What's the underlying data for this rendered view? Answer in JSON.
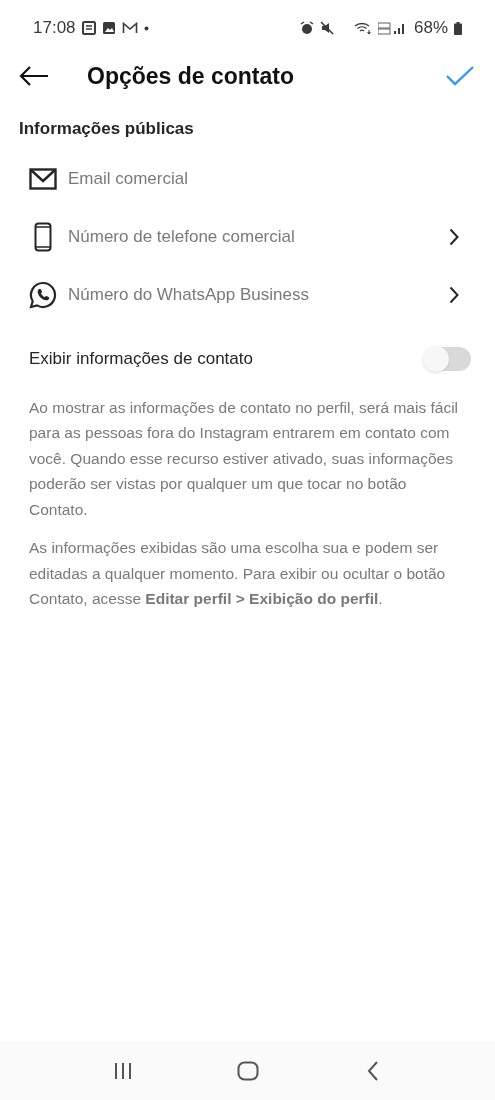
{
  "status_bar": {
    "time": "17:08",
    "battery": "68%"
  },
  "header": {
    "title": "Opções de contato"
  },
  "section_title": "Informações públicas",
  "items": [
    {
      "kind": "email",
      "label": "Email comercial",
      "chevron": false
    },
    {
      "kind": "phone",
      "label": "Número de telefone comercial",
      "chevron": true
    },
    {
      "kind": "whatsapp",
      "label": "Número do WhatsApp Business",
      "chevron": true
    }
  ],
  "display_toggle": {
    "label": "Exibir informações de contato",
    "on": false
  },
  "paragraphs": [
    "Ao mostrar as informações de contato no perfil, será mais fácil para as pessoas fora do Instagram entrarem em contato com você. Quando esse recurso estiver ativado, suas informações poderão ser vistas por qualquer um que tocar no botão Contato.",
    "As informações exibidas são uma escolha sua e podem ser editadas a qualquer momento. Para exibir ou ocultar o botão Contato, acesse **Editar perfil > Exibição do perfil**."
  ]
}
